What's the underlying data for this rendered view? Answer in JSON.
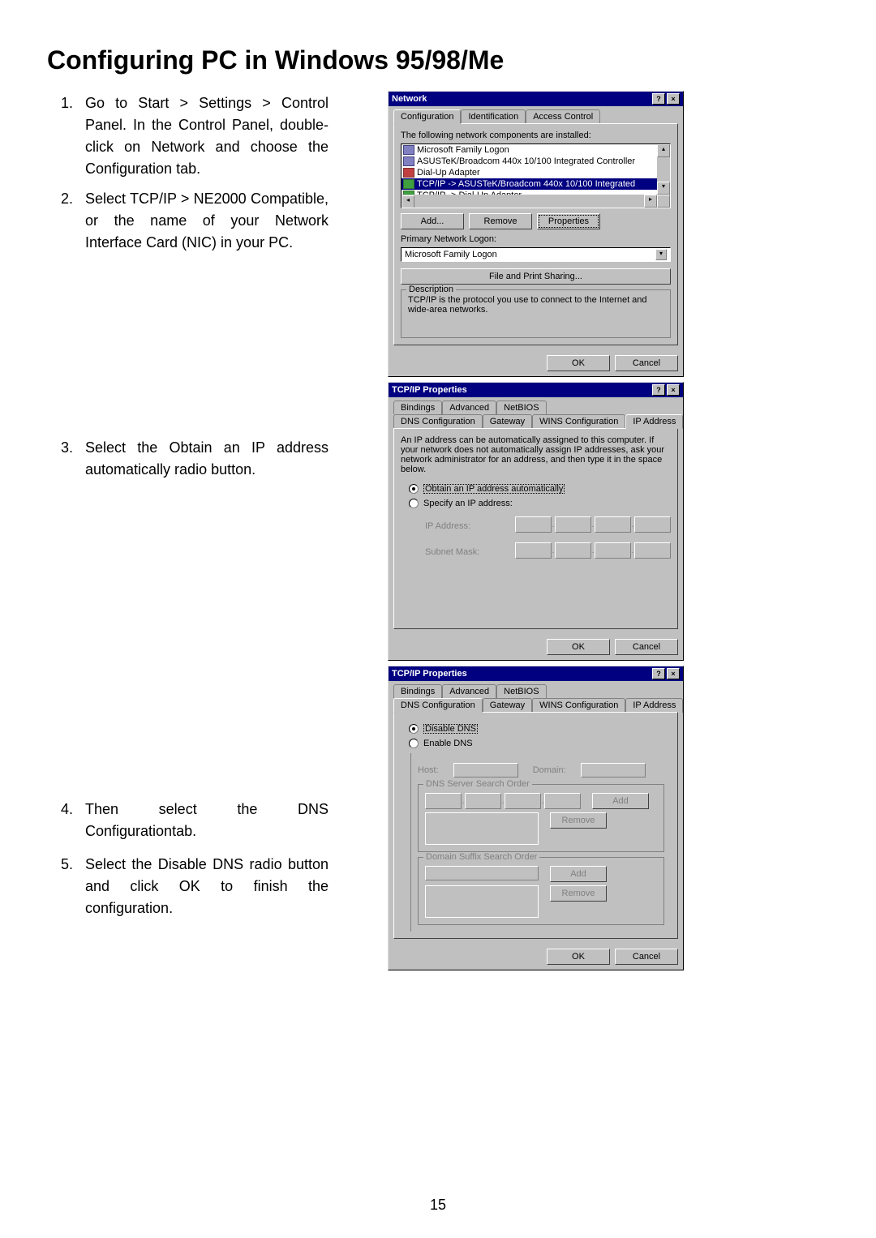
{
  "page_title": "Configuring PC in Windows 95/98/Me",
  "page_number": "15",
  "steps": [
    "Go to Start > Settings > Control Panel. In the Control Panel, double-click on Network and choose the Configuration tab.",
    "Select TCP/IP > NE2000 Compatible, or the name of your Network Interface Card (NIC) in your PC.",
    "Select the Obtain an IP address automatically radio button.",
    "Then select the DNS Configurationtab.",
    "Select the Disable DNS radio button and click OK to finish the configuration."
  ],
  "window1": {
    "title": "Network",
    "tabs": [
      "Configuration",
      "Identification",
      "Access Control"
    ],
    "components_label": "The following network components are installed:",
    "components": [
      "Microsoft Family Logon",
      "ASUSTeK/Broadcom 440x 10/100 Integrated Controller",
      "Dial-Up Adapter",
      "TCP/IP -> ASUSTeK/Broadcom 440x 10/100 Integrated",
      "TCP/IP -> Dial-Up Adapter"
    ],
    "btn_add": "Add...",
    "btn_remove": "Remove",
    "btn_props": "Properties",
    "primary_logon_label": "Primary Network Logon:",
    "primary_logon_value": "Microsoft Family Logon",
    "btn_file_print": "File and Print Sharing...",
    "description_label": "Description",
    "description_text": "TCP/IP is the protocol you use to connect to the Internet and wide-area networks.",
    "btn_ok": "OK",
    "btn_cancel": "Cancel"
  },
  "window2": {
    "title": "TCP/IP Properties",
    "tabs_row1": [
      "Bindings",
      "Advanced",
      "NetBIOS"
    ],
    "tabs_row2": [
      "DNS Configuration",
      "Gateway",
      "WINS Configuration",
      "IP Address"
    ],
    "intro": "An IP address can be automatically assigned to this computer. If your network does not automatically assign IP addresses, ask your network administrator for an address, and then type it in the space below.",
    "radio_auto": "Obtain an IP address automatically",
    "radio_specify": "Specify an IP address:",
    "ip_label": "IP Address:",
    "subnet_label": "Subnet Mask:",
    "btn_ok": "OK",
    "btn_cancel": "Cancel"
  },
  "window3": {
    "title": "TCP/IP Properties",
    "tabs_row1": [
      "Bindings",
      "Advanced",
      "NetBIOS"
    ],
    "tabs_row2": [
      "DNS Configuration",
      "Gateway",
      "WINS Configuration",
      "IP Address"
    ],
    "radio_disable": "Disable DNS",
    "radio_enable": "Enable DNS",
    "host_label": "Host:",
    "domain_label": "Domain:",
    "dns_order_label": "DNS Server Search Order",
    "suffix_order_label": "Domain Suffix Search Order",
    "btn_add": "Add",
    "btn_remove": "Remove",
    "btn_ok": "OK",
    "btn_cancel": "Cancel"
  }
}
